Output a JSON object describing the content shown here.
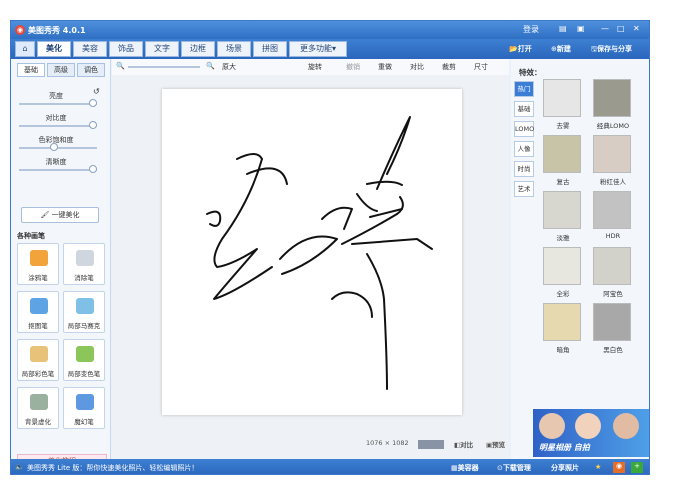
{
  "app": {
    "title": "美图秀秀 4.0.1"
  },
  "titlebar": {
    "login": "登录",
    "min": "—",
    "max": "□",
    "close": "✕"
  },
  "tabs": [
    "美化",
    "美容",
    "饰品",
    "文字",
    "边框",
    "场景",
    "拼图",
    "更多功能"
  ],
  "top_actions": {
    "open": "打开",
    "new": "新建",
    "save": "保存与分享"
  },
  "left": {
    "subtabs": [
      "基础",
      "高级",
      "调色"
    ],
    "sliders": [
      "亮度",
      "对比度",
      "色彩饱和度",
      "清晰度"
    ],
    "slider_levels": [
      0.95,
      0.95,
      0.45,
      0.95
    ],
    "onekey": "一键美化",
    "section_title": "各种画笔",
    "tools": [
      "涂鸦笔",
      "消除笔",
      "抠图笔",
      "局部马赛克",
      "局部彩色笔",
      "局部变色笔",
      "背景虚化",
      "魔幻笔"
    ],
    "beauty": "美化教程"
  },
  "toolbar": {
    "zoom_label": "原大",
    "rotate": "旋转",
    "undo": "撤销",
    "redo": "重做",
    "compare": "对比",
    "crop": "裁剪",
    "size": "尺寸"
  },
  "canvas": {
    "size_text": "1076 × 1082",
    "compare": "对比",
    "preview": "预览"
  },
  "right": {
    "title": "特效：",
    "tabs": [
      "热门",
      "基础",
      "LOMO",
      "人像",
      "时尚",
      "艺术"
    ],
    "effects": [
      "去雾",
      "经典LOMO",
      "复古",
      "粉红佳人",
      "淡雅",
      "HDR",
      "全彩",
      "阿宝色",
      "暗角",
      "黑白色"
    ],
    "ad_text": "明星相册 自拍"
  },
  "status": {
    "left": "美图秀秀 Lite 版：帮你快速美化照片、轻松编辑照片！",
    "items": [
      "美容器",
      "下载管理",
      "分享照片"
    ]
  },
  "colors": {
    "accent": "#3b78c9",
    "bar": "#2f6fc4"
  }
}
